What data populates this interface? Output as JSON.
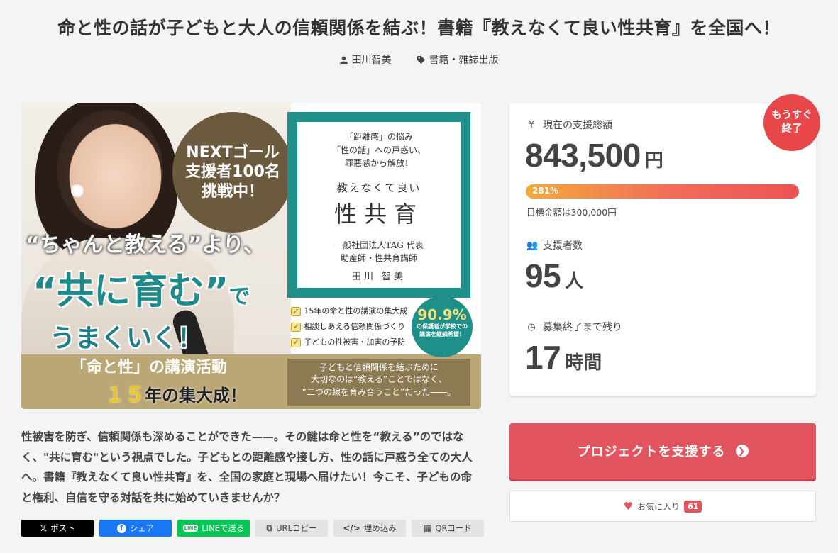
{
  "project": {
    "title": "命と性の話が子どもと大人の信頼関係を結ぶ！書籍『教えなくて良い性共育』を全国へ！",
    "author": "田川智美",
    "category": "書籍・雑誌出版",
    "description": "性被害を防ぎ、信頼関係も深めることができた——。その鍵は命と性を“教える”のではなく、\"共に育む\"という視点でした。子どもとの距離感や接し方、性の話に戸惑う全ての大人へ。書籍『教えなくて良い性共育』を、全国の家庭と現場へ届けたい！今こそ、子どもの命と権利、自信を守る対話を共に始めていきませんか？"
  },
  "hero": {
    "next_goal_l1": "NEXTゴール",
    "next_goal_l2": "支援者100名",
    "next_goal_l3": "挑戦中！",
    "quote": "“ちゃんと教える”より、",
    "big_main": "“共に育む”",
    "big_small": "で",
    "sub": "うまくいく！",
    "lecture": "「命と性」の講演活動",
    "years_num": "１５",
    "years_text": "年の集大成！",
    "book_tag_l1": "「距離感」の悩み",
    "book_tag_l2": "「性の話」への戸惑い、",
    "book_tag_l3": "罪悪感から解放！",
    "book_subtitle": "教えなくて良い",
    "book_title": "性共育",
    "book_org_l1": "一般社団法人TAG 代表",
    "book_org_l2": "助産師・性共育講師",
    "book_author": "田川 智美",
    "checks": [
      "15年の命と性の講演の集大成",
      "相談しあえる信頼関係づくり",
      "子どもの性被害・加害の予防"
    ],
    "pct_value": "90.9%",
    "pct_text": "の保護者が学校での講演を継続希望！",
    "bottom_l1": "子どもと信頼関係を結ぶために",
    "bottom_l2": "大切なのは“教える”ことではなく、",
    "bottom_l3": "“二つの線を育み合うこと”だった――。"
  },
  "share": {
    "x": "ポスト",
    "facebook": "シェア",
    "line": "LINEで送る",
    "url_copy": "URLコピー",
    "embed": "埋め込み",
    "qr": "QRコード"
  },
  "stats": {
    "badge": "もうすぐ終了",
    "badge_l1": "もうすぐ",
    "badge_l2": "終了",
    "amount_label": "現在の支援総額",
    "amount_value": "843,500",
    "amount_unit": "円",
    "progress_percent": 281,
    "progress_text": "281%",
    "goal_text": "目標金額は300,000円",
    "backers_label": "支援者数",
    "backers_value": "95",
    "backers_unit": "人",
    "remaining_label": "募集終了まで残り",
    "remaining_value": "17",
    "remaining_unit": "時間"
  },
  "actions": {
    "support_label": "プロジェクトを支援する",
    "favorite_label": "お気に入り",
    "favorite_count": "61"
  },
  "colors": {
    "accent": "#e2555f",
    "teal": "#1f8f8a",
    "badge": "#e8474a"
  }
}
